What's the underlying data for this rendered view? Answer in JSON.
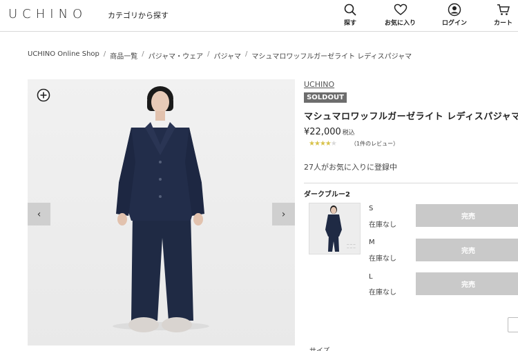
{
  "header": {
    "logo": "UCHINO",
    "category_link": "カテゴリから探す",
    "nav": [
      {
        "label": "探す",
        "icon": "search-icon"
      },
      {
        "label": "お気に入り",
        "icon": "heart-icon"
      },
      {
        "label": "ログイン",
        "icon": "user-icon"
      },
      {
        "label": "カート",
        "icon": "cart-icon"
      }
    ]
  },
  "breadcrumb": [
    "UCHINO Online Shop",
    "商品一覧",
    "パジャマ・ウェア",
    "パジャマ",
    "マシュマロワッフルガーゼライト レディスパジャマ"
  ],
  "gallery": {
    "prev_label": "‹",
    "next_label": "›"
  },
  "product": {
    "brand": "UCHINO",
    "badge": "SOLDOUT",
    "name": "マシュマロワッフルガーゼライト レディスパジャマ",
    "price": "¥22,000",
    "tax_label": "税込",
    "rating": 4,
    "rating_max": 5,
    "reviews": "（1件のレビュー）",
    "favorites": "27人がお気に入りに登録中",
    "color": "ダークブルー2",
    "sizes": [
      {
        "size": "S",
        "stock": "在庫なし",
        "button": "完売"
      },
      {
        "size": "M",
        "stock": "在庫なし",
        "button": "完売"
      },
      {
        "size": "L",
        "stock": "在庫なし",
        "button": "完売"
      }
    ],
    "size_section": "サイズ"
  },
  "colors": {
    "soldout_bg": "#6d6d6d",
    "button_bg": "#c9c9c9",
    "star": "#d8c24a",
    "garment": "#1f2a44"
  }
}
